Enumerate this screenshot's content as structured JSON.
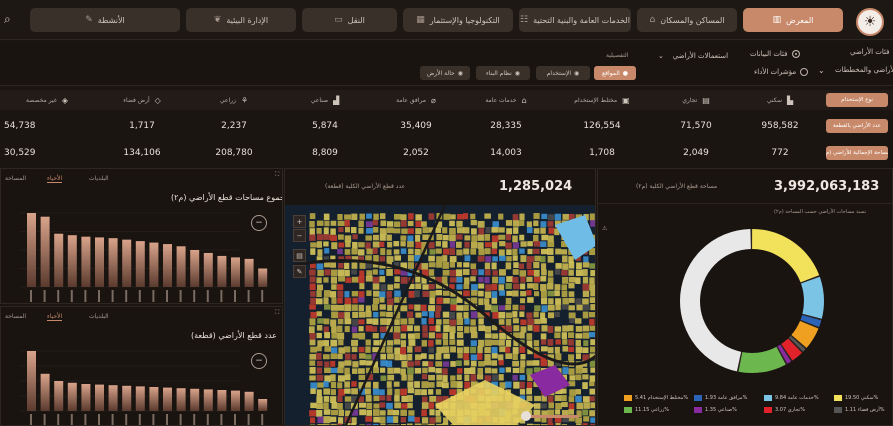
{
  "nav": {
    "items": [
      {
        "label": "المعرض",
        "icon": "building-icon",
        "active": true
      },
      {
        "label": "المساكن والمسكان",
        "icon": "home-icon",
        "active": false
      },
      {
        "label": "الخدمات العامة والبنية التحتية",
        "icon": "services-icon",
        "active": false
      },
      {
        "label": "التكنولوجيا والإستثمار",
        "icon": "chart-icon",
        "active": false
      },
      {
        "label": "النقل",
        "icon": "transport-icon",
        "active": false
      },
      {
        "label": "الإدارة البيئية",
        "icon": "leaf-icon",
        "active": false
      },
      {
        "label": "الأنشطة",
        "icon": "activity-icon",
        "active": false
      }
    ]
  },
  "filters": {
    "left_group_title": "فئات الأراضي",
    "left_group_value": "الأراضي والمخططات",
    "radio_1": "فئات البيانات",
    "radio_2": "مؤشرات الأداء",
    "dropdown_label": "استعمالات الأراضي",
    "section_label": "التفصيلية",
    "chips": [
      "المواقع",
      "الإستخدام",
      "نظام البناء",
      "حالة الأرض"
    ]
  },
  "table": {
    "columns": [
      {
        "label": "سكني",
        "icon": "residential-icon"
      },
      {
        "label": "تجاري",
        "icon": "commercial-icon"
      },
      {
        "label": "مختلط الإستخدام",
        "icon": "mixed-icon"
      },
      {
        "label": "خدمات عامة",
        "icon": "public-services-icon"
      },
      {
        "label": "مرافق عامة",
        "icon": "utilities-icon"
      },
      {
        "label": "صناعي",
        "icon": "industrial-icon"
      },
      {
        "label": "زراعي",
        "icon": "agri-icon"
      },
      {
        "label": "أرض فضاء",
        "icon": "vacant-icon"
      },
      {
        "label": "غير مخصصة",
        "icon": "unassigned-icon"
      }
    ],
    "header_label": "نوع الإستخدام",
    "rows": [
      {
        "label": "عدد الأراضي بالقطعة",
        "values": [
          "958,582",
          "71,570",
          "126,554",
          "28,335",
          "35,409",
          "5,874",
          "2,237",
          "1,717",
          "54,738"
        ]
      },
      {
        "label": "المساحة الإجمالية للأراضي (م٢)",
        "values": [
          "772",
          "2,049",
          "1,708",
          "14,003",
          "2,052",
          "8,809",
          "208,780",
          "134,106",
          "30,529"
        ]
      }
    ]
  },
  "panel_bar1": {
    "title": "مجموع مساحات قطع الأراضي (م٢)",
    "tabs": [
      "المساحة",
      "الأحياء",
      "البلديات"
    ],
    "categories": [
      "a",
      "b",
      "c",
      "d",
      "e",
      "f",
      "g",
      "h",
      "i",
      "j",
      "k",
      "l",
      "m",
      "n",
      "o",
      "p",
      "q",
      "r"
    ],
    "values": [
      100,
      95,
      72,
      70,
      68,
      67,
      66,
      64,
      62,
      60,
      58,
      55,
      50,
      46,
      42,
      40,
      38,
      25
    ]
  },
  "panel_bar2": {
    "title": "عدد قطع الأراضي (قطعة)",
    "tabs": [
      "المساحة",
      "الأحياء",
      "البلديات"
    ],
    "values": [
      100,
      62,
      50,
      47,
      45,
      44,
      43,
      42,
      41,
      40,
      39,
      38,
      37,
      36,
      35,
      34,
      32,
      20
    ]
  },
  "map_panel": {
    "title": "عدد قطع الأراضي الكلية (قطعة)",
    "value": "1,285,024"
  },
  "donut_panel": {
    "title": "مساحة قطع الأراضي الكلية (م٢)",
    "value": "3,992,063,183",
    "chart_title": "نسبة مساحات الأراضي حسب المساحة (م٢)"
  },
  "chart_data": {
    "type": "pie",
    "title": "نسبة مساحات الأراضي حسب المساحة (م٢)",
    "categories": [
      "سكني",
      "خدمات عامة",
      "مرافق عامة",
      "مختلط الإستخدام",
      "أرض فضاء",
      "تجاري",
      "صناعي",
      "زراعي",
      "غير مخصصة"
    ],
    "values": [
      19.5,
      9.84,
      1.93,
      5.41,
      1.11,
      3.07,
      1.35,
      11.15,
      46.64
    ],
    "value_labels": [
      "19.50%",
      "9.84%",
      "1.93%",
      "5.41%",
      "1.11%",
      "3.07%",
      "1.35%",
      "11.15%",
      ""
    ],
    "colors": [
      "#f2e15a",
      "#7cc4e6",
      "#2a63b8",
      "#f0a020",
      "#555555",
      "#e2222a",
      "#8a2aa0",
      "#6db84e",
      "#e8e8e8"
    ],
    "legend": [
      "سكني 19.50%",
      "خدمات عامة 9.84%",
      "مرافق عامة 1.93%",
      "مختلط الإستخدام 5.41%",
      "أرض فضاء 1.11%",
      "تجاري 3.07%",
      "صناعي 1.35%",
      "زراعي 11.15%"
    ]
  }
}
